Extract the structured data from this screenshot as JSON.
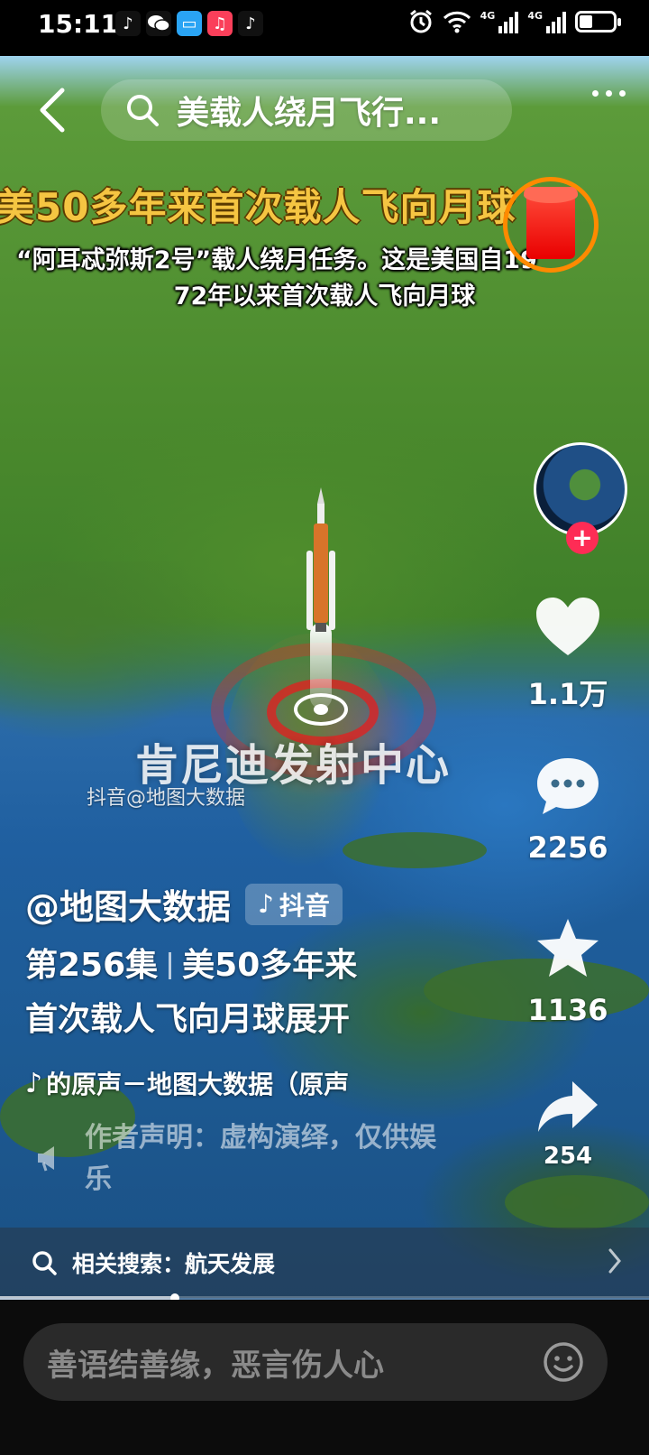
{
  "status_bar": {
    "time": "15:11",
    "network_1": "4G",
    "network_2": "4G",
    "battery_level": 0.4
  },
  "top_bar": {
    "search_query": "美载人绕月飞行..."
  },
  "video_overlay": {
    "headline": "美50多年来首次载人飞向月球",
    "subtitle_line1": "“阿耳忒弥斯2号”载人绕月任务。这是美国自19",
    "subtitle_line2": "72年以来首次载人飞向月球",
    "place_label": "肯尼迪发射中心",
    "watermark": "抖音@地图大数据"
  },
  "right_rail": {
    "like_count": "1.1万",
    "comment_count": "2256",
    "favorite_count": "1136",
    "share_count": "254",
    "follow_symbol": "+"
  },
  "post": {
    "author": "@地图大数据",
    "platform_tag": "抖音",
    "episode": "第256集",
    "title_part1": "美50多年来",
    "title_part2": "首次载人飞向月球",
    "expand_label": "展开",
    "music": "的原声－地图大数据（原声",
    "declaration": "作者声明：虚构演绎，仅供娱乐"
  },
  "related_search": {
    "label": "相关搜索：航天发展",
    "progress": 0.27
  },
  "comment_bar": {
    "placeholder": "善语结善缘，恶言伤人心"
  }
}
